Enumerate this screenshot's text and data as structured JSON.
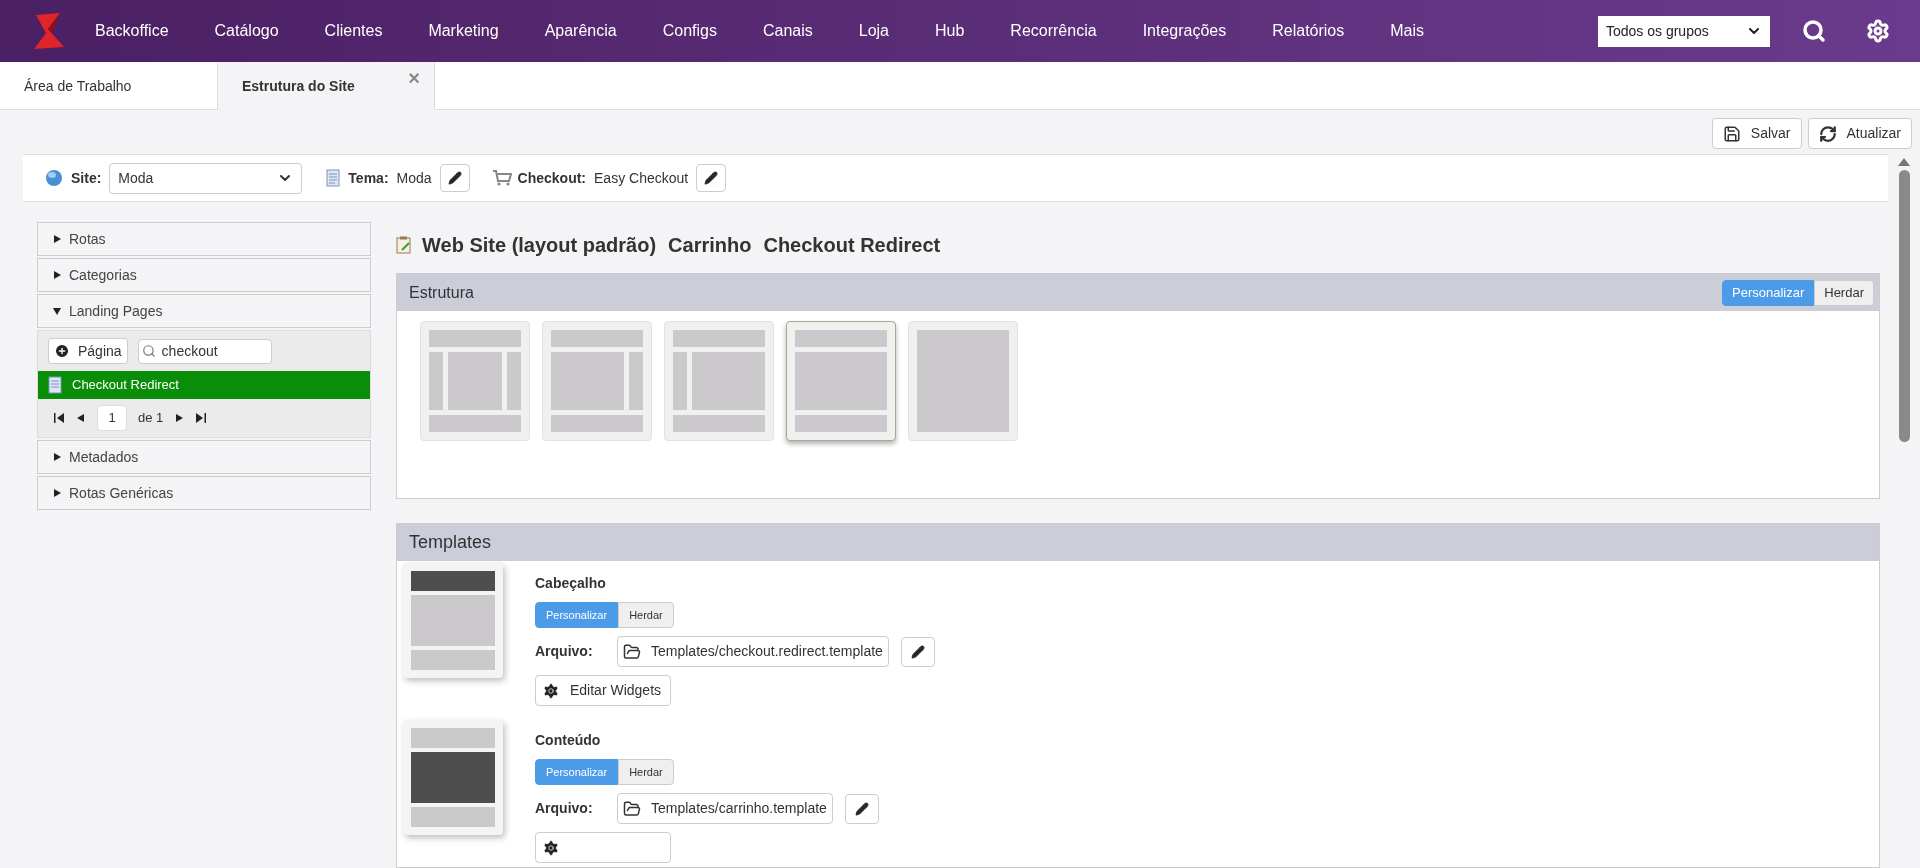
{
  "nav": {
    "items": [
      "Backoffice",
      "Catálogo",
      "Clientes",
      "Marketing",
      "Aparência",
      "Configs",
      "Canais",
      "Loja",
      "Hub",
      "Recorrência",
      "Integrações",
      "Relatórios",
      "Mais"
    ],
    "group_select": "Todos os grupos"
  },
  "tabs": [
    {
      "label": "Área de Trabalho",
      "selected": false,
      "closable": false
    },
    {
      "label": "Estrutura do Site",
      "selected": true,
      "closable": true
    }
  ],
  "close_glyph": "×",
  "toolbar": [
    "Salvar",
    "Atualizar"
  ],
  "site_bar": {
    "site_label": "Site:",
    "site_value": "Moda",
    "theme_label": "Tema:",
    "theme_value": "Moda",
    "checkout_label": "Checkout:",
    "checkout_value": "Easy Checkout"
  },
  "sidebar": {
    "sections": [
      {
        "label": "Rotas",
        "expanded": false
      },
      {
        "label": "Categorias",
        "expanded": false
      },
      {
        "label": "Landing Pages",
        "expanded": true,
        "add_button": "Página",
        "search_value": "checkout",
        "items": [
          {
            "label": "Checkout Redirect",
            "selected": true
          }
        ],
        "pager": {
          "page": "1",
          "of": "de 1"
        }
      },
      {
        "label": "Metadados",
        "expanded": false
      },
      {
        "label": "Rotas Genéricas",
        "expanded": false
      }
    ]
  },
  "title_parts": [
    "Web Site (layout padrão)",
    "Carrinho",
    "Checkout Redirect"
  ],
  "estrutura": {
    "title": "Estrutura",
    "toggle": [
      {
        "label": "Personalizar",
        "selected": true
      },
      {
        "label": "Herdar",
        "selected": false
      }
    ],
    "layouts": [
      {
        "kind": "three-columns",
        "selected": false
      },
      {
        "kind": "right-column",
        "selected": false
      },
      {
        "kind": "left-column",
        "selected": false
      },
      {
        "kind": "single-column",
        "selected": true
      },
      {
        "kind": "blank",
        "selected": false
      }
    ]
  },
  "templates": {
    "title": "Templates",
    "items": [
      {
        "title": "Cabeçalho",
        "kind": "header",
        "toggle": [
          {
            "label": "Personalizar",
            "selected": true
          },
          {
            "label": "Herdar",
            "selected": false
          }
        ],
        "file_label": "Arquivo:",
        "file": "Templates/checkout.redirect.template",
        "widgets": "Editar Widgets"
      },
      {
        "title": "Conteúdo",
        "kind": "content",
        "toggle": [
          {
            "label": "Personalizar",
            "selected": true
          },
          {
            "label": "Herdar",
            "selected": false
          }
        ],
        "file_label": "Arquivo:",
        "file": "Templates/carrinho.template"
      }
    ]
  }
}
